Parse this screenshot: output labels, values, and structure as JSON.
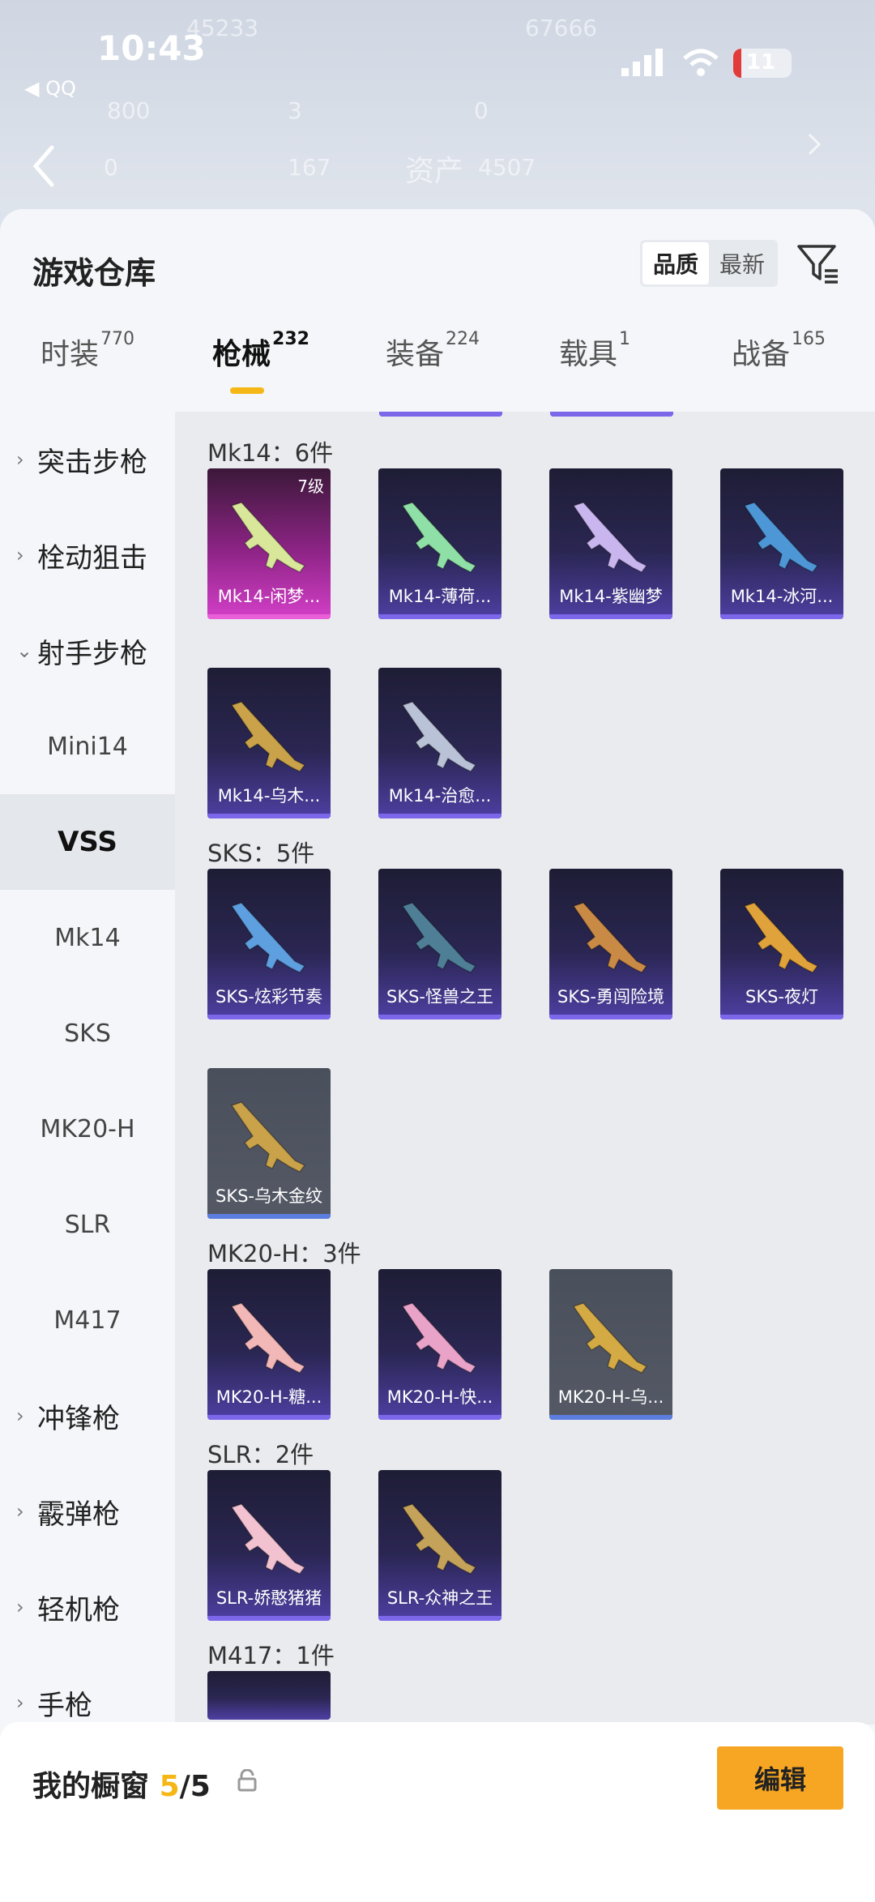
{
  "status_bar": {
    "time": "10:43",
    "back_app": "◀ QQ",
    "battery": "11"
  },
  "background": {
    "asset_label": "资产",
    "values": [
      "45233",
      "67666",
      "800",
      "3",
      "0",
      "0",
      "167",
      "4507"
    ]
  },
  "header": {
    "title": "游戏仓库",
    "sort_options": [
      "品质",
      "最新"
    ],
    "active_sort": 0
  },
  "tabs": [
    {
      "label": "时装",
      "count": "770"
    },
    {
      "label": "枪械",
      "count": "232"
    },
    {
      "label": "装备",
      "count": "224"
    },
    {
      "label": "载具",
      "count": "1"
    },
    {
      "label": "战备",
      "count": "165"
    }
  ],
  "active_tab": 1,
  "sidebar": [
    {
      "label": "突击步枪",
      "type": "cat",
      "chev": "›"
    },
    {
      "label": "栓动狙击",
      "type": "cat",
      "chev": "›"
    },
    {
      "label": "射手步枪",
      "type": "cat",
      "chev": "⌄"
    },
    {
      "label": "Mini14",
      "type": "sub"
    },
    {
      "label": "VSS",
      "type": "sub",
      "selected": true
    },
    {
      "label": "Mk14",
      "type": "sub"
    },
    {
      "label": "SKS",
      "type": "sub"
    },
    {
      "label": "MK20-H",
      "type": "sub"
    },
    {
      "label": "SLR",
      "type": "sub"
    },
    {
      "label": "M417",
      "type": "sub"
    },
    {
      "label": "冲锋枪",
      "type": "cat",
      "chev": "›"
    },
    {
      "label": "霰弹枪",
      "type": "cat",
      "chev": "›"
    },
    {
      "label": "轻机枪",
      "type": "cat",
      "chev": "›"
    },
    {
      "label": "手枪",
      "type": "cat",
      "chev": "›"
    }
  ],
  "groups": [
    {
      "heading": "Mk14：6件",
      "items": [
        {
          "name": "Mk14-闲梦...",
          "quality": "pink",
          "level": "7级",
          "gun": "#d9e79a"
        },
        {
          "name": "Mk14-薄荷...",
          "quality": "purple",
          "gun": "#8fe0a6"
        },
        {
          "name": "Mk14-紫幽梦",
          "quality": "purple",
          "gun": "#c9b6ef"
        },
        {
          "name": "Mk14-冰河...",
          "quality": "purple",
          "gun": "#4e97d6"
        },
        {
          "name": "Mk14-乌木...",
          "quality": "purple",
          "gun": "#c9a24a"
        },
        {
          "name": "Mk14-治愈...",
          "quality": "purple",
          "gun": "#b9c2d6"
        }
      ]
    },
    {
      "heading": "SKS：5件",
      "items": [
        {
          "name": "SKS-炫彩节奏",
          "quality": "purple",
          "gun": "#5e9fe0"
        },
        {
          "name": "SKS-怪兽之王",
          "quality": "purple",
          "gun": "#4f7f96"
        },
        {
          "name": "SKS-勇闯险境",
          "quality": "purple",
          "gun": "#c98a46"
        },
        {
          "name": "SKS-夜灯",
          "quality": "purple",
          "gun": "#e0a23a"
        },
        {
          "name": "SKS-乌木金纹",
          "quality": "grey",
          "gun": "#c9a24a"
        }
      ]
    },
    {
      "heading": "MK20-H：3件",
      "items": [
        {
          "name": "MK20-H-糖...",
          "quality": "purple",
          "gun": "#f2b7b7"
        },
        {
          "name": "MK20-H-快...",
          "quality": "purple",
          "gun": "#e9a2c8"
        },
        {
          "name": "MK20-H-乌...",
          "quality": "grey",
          "gun": "#d4aa44"
        }
      ]
    },
    {
      "heading": "SLR：2件",
      "items": [
        {
          "name": "SLR-娇憨猪猪",
          "quality": "purple",
          "gun": "#f3c2d1"
        },
        {
          "name": "SLR-众神之王",
          "quality": "purple",
          "gun": "#c4a25a"
        }
      ]
    },
    {
      "heading": "M417：1件",
      "items": []
    }
  ],
  "showcase": {
    "label": "我的橱窗",
    "current": "5",
    "total": "/5"
  },
  "edit_button": "编辑"
}
